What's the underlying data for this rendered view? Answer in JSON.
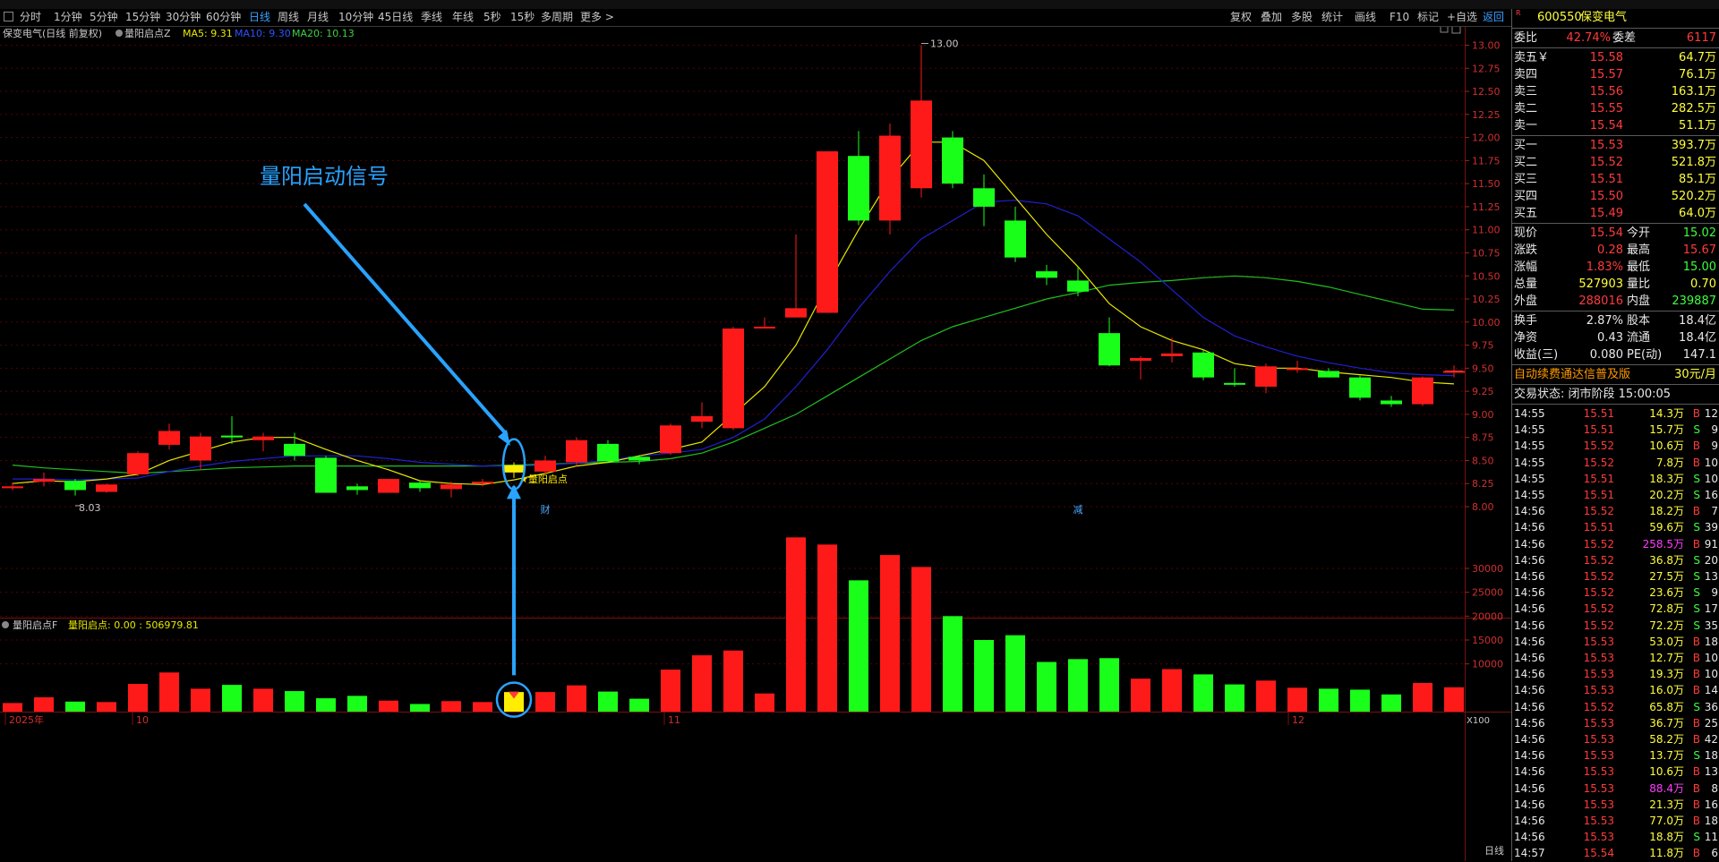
{
  "period_tabs": [
    "分时",
    "1分钟",
    "5分钟",
    "15分钟",
    "30分钟",
    "60分钟",
    "日线",
    "周线",
    "月线",
    "10分钟",
    "45日线",
    "季线",
    "年线",
    "5秒",
    "15秒",
    "多周期",
    "更多 >"
  ],
  "active_tab": "日线",
  "right_buttons": [
    "复权",
    "叠加",
    "多股",
    "统计",
    "画线",
    "F10",
    "标记",
    "+自选",
    "返回"
  ],
  "chart": {
    "title": "保变电气(日线 前复权)",
    "indicator_name": "量阳启点Z",
    "ma5": "MA5: 9.31",
    "ma10": "MA10: 9.30",
    "ma20": "MA20: 10.13",
    "annotation_text": "量阳启动信号",
    "signal_label": "★量阳启点",
    "high_label": "13.00",
    "low_label": "8.03",
    "event_cai": "财",
    "event_jian": "减",
    "vol_title": "量阳启点F",
    "vol_value_label": "量阳启点: 0.00 : 506979.81",
    "x_labels": [
      "2025年",
      "10",
      "11",
      "12"
    ],
    "x100": "X100",
    "period_label": "日线",
    "colors": {
      "up": "#ff1a1a",
      "down": "#1aff1a",
      "signal": "#ffee00",
      "ma5": "#e8e800",
      "ma10": "#2020d0",
      "ma20": "#20c020",
      "arrow": "#29a3ff"
    }
  },
  "chart_data": {
    "type": "candlestick",
    "price_ticks": [
      "13.00",
      "12.75",
      "12.50",
      "12.25",
      "12.00",
      "11.75",
      "11.50",
      "11.25",
      "11.00",
      "10.75",
      "10.50",
      "10.25",
      "10.00",
      "9.75",
      "9.50",
      "9.25",
      "9.00",
      "8.75",
      "8.50",
      "8.25",
      "8.00"
    ],
    "volume_ticks": [
      "30000",
      "25000",
      "20000",
      "15000",
      "10000"
    ],
    "ohlc": [
      [
        8.22,
        8.26,
        8.18,
        8.2
      ],
      [
        8.27,
        8.37,
        8.22,
        8.3
      ],
      [
        8.28,
        8.3,
        8.12,
        8.18
      ],
      [
        8.16,
        8.25,
        8.15,
        8.24
      ],
      [
        8.35,
        8.6,
        8.33,
        8.58
      ],
      [
        8.67,
        8.9,
        8.62,
        8.82
      ],
      [
        8.5,
        8.8,
        8.4,
        8.76
      ],
      [
        8.75,
        8.98,
        8.68,
        8.77
      ],
      [
        8.76,
        8.8,
        8.6,
        8.72
      ],
      [
        8.68,
        8.8,
        8.5,
        8.55
      ],
      [
        8.53,
        8.55,
        8.15,
        8.15
      ],
      [
        8.22,
        8.25,
        8.13,
        8.18
      ],
      [
        8.15,
        8.3,
        8.15,
        8.3
      ],
      [
        8.26,
        8.28,
        8.16,
        8.2
      ],
      [
        8.19,
        8.27,
        8.1,
        8.24
      ],
      [
        8.25,
        8.3,
        8.22,
        8.27
      ],
      [
        8.37,
        8.48,
        8.31,
        8.45
      ],
      [
        8.38,
        8.55,
        8.35,
        8.5
      ],
      [
        8.48,
        8.75,
        8.44,
        8.72
      ],
      [
        8.68,
        8.72,
        8.47,
        8.49
      ],
      [
        8.5,
        8.56,
        8.46,
        8.54
      ],
      [
        8.58,
        8.9,
        8.56,
        8.88
      ],
      [
        8.92,
        9.13,
        8.85,
        8.98
      ],
      [
        8.85,
        9.95,
        8.83,
        9.93
      ],
      [
        9.95,
        10.05,
        9.93,
        9.95
      ],
      [
        10.05,
        10.95,
        10.6,
        10.15
      ],
      [
        10.1,
        11.35,
        10.95,
        11.85
      ],
      [
        11.1,
        12.07,
        11.05,
        11.8
      ],
      [
        11.1,
        12.15,
        10.95,
        12.02
      ],
      [
        11.45,
        13.0,
        11.35,
        12.4
      ],
      [
        11.5,
        12.07,
        11.45,
        12.0
      ],
      [
        11.25,
        11.6,
        11.04,
        11.45
      ],
      [
        10.7,
        11.25,
        10.65,
        11.1
      ],
      [
        10.48,
        10.62,
        10.4,
        10.55
      ],
      [
        10.33,
        10.6,
        10.28,
        10.45
      ],
      [
        9.53,
        10.05,
        9.52,
        9.88
      ],
      [
        9.58,
        9.63,
        9.38,
        9.61
      ],
      [
        9.66,
        9.83,
        9.56,
        9.63
      ],
      [
        9.4,
        9.7,
        9.37,
        9.67
      ],
      [
        9.33,
        9.5,
        9.3,
        9.34
      ],
      [
        9.52,
        9.55,
        9.23,
        9.3
      ],
      [
        9.48,
        9.58,
        9.45,
        9.5
      ],
      [
        9.4,
        9.5,
        9.42,
        9.47
      ],
      [
        9.18,
        9.42,
        9.15,
        9.4
      ],
      [
        9.15,
        9.2,
        9.08,
        9.11
      ],
      [
        9.4,
        9.41,
        9.09,
        9.11
      ],
      [
        9.47,
        9.53,
        9.4,
        9.47
      ]
    ],
    "updown": [
      "u",
      "u",
      "d",
      "u",
      "u",
      "u",
      "u",
      "d",
      "u",
      "d",
      "d",
      "d",
      "u",
      "d",
      "u",
      "u",
      "s",
      "u",
      "u",
      "d",
      "d",
      "u",
      "u",
      "u",
      "u",
      "u",
      "u",
      "d",
      "u",
      "u",
      "d",
      "d",
      "d",
      "d",
      "d",
      "d",
      "u",
      "u",
      "d",
      "d",
      "u",
      "u",
      "d",
      "d",
      "d",
      "u",
      "u"
    ],
    "volume": [
      1800,
      3000,
      2100,
      2000,
      5800,
      8200,
      4800,
      5600,
      4800,
      4300,
      2800,
      3300,
      2300,
      1600,
      2200,
      2000,
      4100,
      4100,
      5500,
      4200,
      2700,
      8800,
      11800,
      12800,
      3800,
      36500,
      35000,
      27500,
      32800,
      30300,
      20000,
      15000,
      16000,
      10400,
      11000,
      11200,
      6900,
      8900,
      7800,
      5700,
      6500,
      5000,
      4800,
      4600,
      3600,
      6000,
      5100
    ],
    "ma5": [
      8.25,
      8.28,
      8.27,
      8.3,
      8.35,
      8.5,
      8.6,
      8.7,
      8.75,
      8.75,
      8.62,
      8.5,
      8.4,
      8.28,
      8.25,
      8.24,
      8.29,
      8.36,
      8.44,
      8.48,
      8.55,
      8.62,
      8.7,
      9.0,
      9.3,
      9.75,
      10.4,
      11.0,
      11.55,
      11.95,
      11.95,
      11.75,
      11.35,
      10.95,
      10.6,
      10.2,
      9.95,
      9.8,
      9.7,
      9.55,
      9.5,
      9.5,
      9.46,
      9.43,
      9.4,
      9.35,
      9.33
    ],
    "ma10": [
      8.3,
      8.3,
      8.29,
      8.3,
      8.31,
      8.38,
      8.44,
      8.49,
      8.52,
      8.55,
      8.55,
      8.55,
      8.52,
      8.48,
      8.46,
      8.44,
      8.44,
      8.45,
      8.47,
      8.5,
      8.55,
      8.58,
      8.62,
      8.75,
      8.95,
      9.3,
      9.7,
      10.15,
      10.55,
      10.9,
      11.1,
      11.3,
      11.32,
      11.28,
      11.15,
      10.9,
      10.65,
      10.35,
      10.05,
      9.85,
      9.73,
      9.63,
      9.56,
      9.5,
      9.45,
      9.43,
      9.42
    ],
    "ma20": [
      8.45,
      8.42,
      8.4,
      8.38,
      8.36,
      8.38,
      8.4,
      8.42,
      8.43,
      8.44,
      8.44,
      8.44,
      8.44,
      8.44,
      8.44,
      8.44,
      8.45,
      8.46,
      8.47,
      8.48,
      8.49,
      8.52,
      8.58,
      8.7,
      8.85,
      9.0,
      9.2,
      9.4,
      9.6,
      9.8,
      9.95,
      10.05,
      10.15,
      10.25,
      10.32,
      10.4,
      10.43,
      10.45,
      10.48,
      10.5,
      10.48,
      10.44,
      10.38,
      10.3,
      10.22,
      10.14,
      10.13
    ],
    "signal_index": 16
  },
  "panel": {
    "stock_code": "600550",
    "stock_name": "保变电气",
    "weibi_label": "委比",
    "weibi_value": "42.74%",
    "weicha_label": "委差",
    "weicha_value": "6117",
    "asks": [
      {
        "label": "卖五￥",
        "price": "15.58",
        "vol": "64.7万"
      },
      {
        "label": "卖四",
        "price": "15.57",
        "vol": "76.1万"
      },
      {
        "label": "卖三",
        "price": "15.56",
        "vol": "163.1万"
      },
      {
        "label": "卖二",
        "price": "15.55",
        "vol": "282.5万"
      },
      {
        "label": "卖一",
        "price": "15.54",
        "vol": "51.1万"
      }
    ],
    "bids": [
      {
        "label": "买一",
        "price": "15.53",
        "vol": "393.7万"
      },
      {
        "label": "买二",
        "price": "15.52",
        "vol": "521.8万"
      },
      {
        "label": "买三",
        "price": "15.51",
        "vol": "85.1万"
      },
      {
        "label": "买四",
        "price": "15.50",
        "vol": "520.2万"
      },
      {
        "label": "买五",
        "price": "15.49",
        "vol": "64.0万"
      }
    ],
    "stats": [
      {
        "l1": "现价",
        "v1": "15.54",
        "c1": "red",
        "l2": "今开",
        "v2": "15.02",
        "c2": "grn"
      },
      {
        "l1": "涨跌",
        "v1": "0.28",
        "c1": "red",
        "l2": "最高",
        "v2": "15.67",
        "c2": "red"
      },
      {
        "l1": "涨幅",
        "v1": "1.83%",
        "c1": "red",
        "l2": "最低",
        "v2": "15.00",
        "c2": "grn"
      },
      {
        "l1": "总量",
        "v1": "527903",
        "c1": "yel",
        "l2": "量比",
        "v2": "0.70",
        "c2": "yel"
      },
      {
        "l1": "外盘",
        "v1": "288016",
        "c1": "red",
        "l2": "内盘",
        "v2": "239887",
        "c2": "grn"
      }
    ],
    "stats2": [
      {
        "l1": "换手",
        "v1": "2.87%",
        "l2": "股本",
        "v2": "18.4亿"
      },
      {
        "l1": "净资",
        "v1": "0.43",
        "l2": "流通",
        "v2": "18.4亿"
      },
      {
        "l1": "收益(三)",
        "v1": "0.080",
        "l2": "PE(动)",
        "v2": "147.1"
      }
    ],
    "promo": "自动续费通达信普及版",
    "promo_price": "30元/月",
    "trade_status": "交易状态: 闭市阶段 15:00:05",
    "ticks": [
      {
        "t": "14:55",
        "p": "15.51",
        "v": "14.3万",
        "s": "B",
        "n": "12"
      },
      {
        "t": "14:55",
        "p": "15.51",
        "v": "15.7万",
        "s": "S",
        "n": "9"
      },
      {
        "t": "14:55",
        "p": "15.52",
        "v": "10.6万",
        "s": "B",
        "n": "9"
      },
      {
        "t": "14:55",
        "p": "15.52",
        "v": "7.8万",
        "s": "B",
        "n": "10"
      },
      {
        "t": "14:55",
        "p": "15.51",
        "v": "18.3万",
        "s": "S",
        "n": "10"
      },
      {
        "t": "14:55",
        "p": "15.51",
        "v": "20.2万",
        "s": "S",
        "n": "16"
      },
      {
        "t": "14:56",
        "p": "15.52",
        "v": "18.2万",
        "s": "B",
        "n": "7"
      },
      {
        "t": "14:56",
        "p": "15.51",
        "v": "59.6万",
        "s": "S",
        "n": "39"
      },
      {
        "t": "14:56",
        "p": "15.52",
        "v": "258.5万",
        "s": "B",
        "n": "91"
      },
      {
        "t": "14:56",
        "p": "15.52",
        "v": "36.8万",
        "s": "S",
        "n": "20"
      },
      {
        "t": "14:56",
        "p": "15.52",
        "v": "27.5万",
        "s": "S",
        "n": "13"
      },
      {
        "t": "14:56",
        "p": "15.52",
        "v": "23.6万",
        "s": "S",
        "n": "9"
      },
      {
        "t": "14:56",
        "p": "15.52",
        "v": "72.8万",
        "s": "S",
        "n": "17"
      },
      {
        "t": "14:56",
        "p": "15.52",
        "v": "72.2万",
        "s": "S",
        "n": "35"
      },
      {
        "t": "14:56",
        "p": "15.53",
        "v": "53.0万",
        "s": "B",
        "n": "18"
      },
      {
        "t": "14:56",
        "p": "15.53",
        "v": "12.7万",
        "s": "B",
        "n": "10"
      },
      {
        "t": "14:56",
        "p": "15.53",
        "v": "19.3万",
        "s": "B",
        "n": "10"
      },
      {
        "t": "14:56",
        "p": "15.53",
        "v": "16.0万",
        "s": "B",
        "n": "14"
      },
      {
        "t": "14:56",
        "p": "15.52",
        "v": "65.8万",
        "s": "S",
        "n": "36"
      },
      {
        "t": "14:56",
        "p": "15.53",
        "v": "36.7万",
        "s": "B",
        "n": "25"
      },
      {
        "t": "14:56",
        "p": "15.53",
        "v": "58.2万",
        "s": "B",
        "n": "42"
      },
      {
        "t": "14:56",
        "p": "15.53",
        "v": "13.7万",
        "s": "S",
        "n": "18"
      },
      {
        "t": "14:56",
        "p": "15.53",
        "v": "10.6万",
        "s": "B",
        "n": "13"
      },
      {
        "t": "14:56",
        "p": "15.53",
        "v": "88.4万",
        "s": "B",
        "n": "8"
      },
      {
        "t": "14:56",
        "p": "15.53",
        "v": "21.3万",
        "s": "B",
        "n": "16"
      },
      {
        "t": "14:56",
        "p": "15.53",
        "v": "77.0万",
        "s": "B",
        "n": "18"
      },
      {
        "t": "14:56",
        "p": "15.53",
        "v": "18.8万",
        "s": "S",
        "n": "11"
      },
      {
        "t": "14:57",
        "p": "15.54",
        "v": "11.8万",
        "s": "B",
        "n": "6"
      }
    ]
  }
}
